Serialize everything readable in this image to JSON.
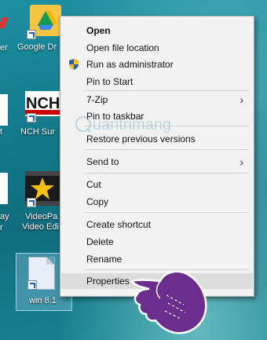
{
  "desktop": {
    "icons": [
      {
        "label": "Google Dr",
        "name": "google-drive"
      },
      {
        "label": "NCH Sur",
        "name": "nch-suite"
      },
      {
        "label": "VideoPa",
        "label2": "Video Edi",
        "name": "videopad"
      },
      {
        "label": "win 8.1",
        "name": "win-8-1-file"
      }
    ],
    "left_edge_labels": [
      "er",
      "t",
      "",
      "ay",
      "r"
    ]
  },
  "context_menu": {
    "items": [
      {
        "label": "Open",
        "bold": true
      },
      {
        "label": "Open file location"
      },
      {
        "label": "Run as administrator",
        "icon": "uac-shield-icon"
      },
      {
        "label": "Pin to Start"
      },
      {
        "label": "7-Zip",
        "submenu": true
      },
      {
        "label": "Pin to taskbar"
      },
      {
        "label": "Restore previous versions"
      },
      {
        "label": "Send to",
        "submenu": true
      },
      {
        "label": "Cut"
      },
      {
        "label": "Copy"
      },
      {
        "label": "Create shortcut"
      },
      {
        "label": "Delete"
      },
      {
        "label": "Rename"
      },
      {
        "label": "Properties",
        "highlighted": true
      }
    ]
  },
  "watermark": {
    "text": "uantrimang"
  },
  "colors": {
    "accent": "#1f5fb8",
    "menu_bg": "#f2f2f2",
    "highlight": "#dcdcdc"
  }
}
